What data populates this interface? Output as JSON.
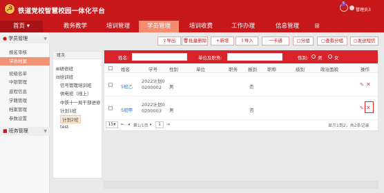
{
  "app": {
    "title": "铁道党校智慧校园一体化平台"
  },
  "topright": {
    "badge": "5",
    "user": "管理员3"
  },
  "nav": [
    {
      "label": "首页 ▾"
    },
    {
      "label": "教务教学"
    },
    {
      "label": "培训管理"
    },
    {
      "label": "学员管理"
    },
    {
      "label": "培训收费"
    },
    {
      "label": "工作办理"
    },
    {
      "label": "信息管理"
    },
    {
      "label": "⊞"
    }
  ],
  "sidebar": {
    "group1": "学员管理",
    "items": [
      "报名审核",
      "学员档案",
      "班级名单",
      "中银管理",
      "返程信息",
      "学籍管理",
      "档案管理",
      "参数设置"
    ],
    "group2": "班务管理"
  },
  "classpanel": {
    "header": "班次",
    "tree": [
      "研修班",
      "培训班"
    ],
    "classes": [
      "信号管理培训班",
      "供电班（线上）",
      "中铁十一局干部进修",
      "计划1班",
      "计划2班",
      "test"
    ]
  },
  "toolbar": [
    "导出",
    "批量删除",
    "+新增",
    "导入",
    "一卡通",
    "分组",
    "查看分组",
    "发送短信"
  ],
  "search": {
    "name_label": "姓名:",
    "unit_label": "单位及职务:",
    "gender_label": "性别:",
    "male": "男",
    "female": "女"
  },
  "table": {
    "headers": [
      "姓名",
      "学号",
      "性别",
      "单位",
      "职务",
      "报到",
      "职称",
      "级别",
      "政治面貌",
      "操作"
    ],
    "rows": [
      {
        "name": "5班乙",
        "id_line1": "2022计划0",
        "id_line2": "0200002",
        "gender": "男",
        "report": "否"
      },
      {
        "name": "5班甲",
        "id_line1": "2022计划0",
        "id_line2": "0200003",
        "gender": "男",
        "report": "否"
      }
    ]
  },
  "pager": {
    "size": "15",
    "page_text": "第1/1页",
    "page_input": "1",
    "summary": "显示1到2，共2条记录"
  }
}
